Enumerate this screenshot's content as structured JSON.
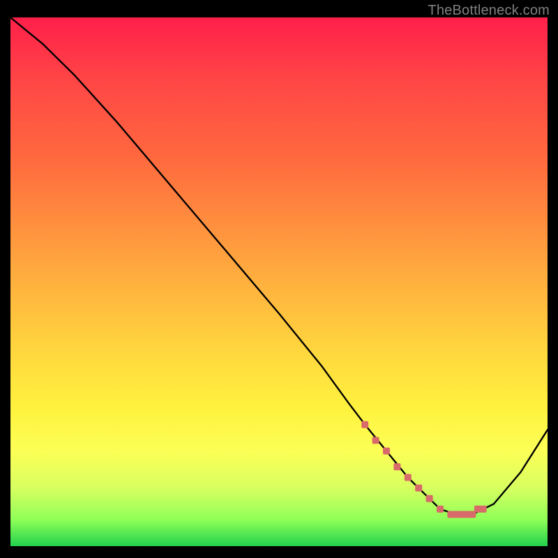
{
  "watermark": "TheBottleneck.com",
  "chart_data": {
    "type": "line",
    "title": "",
    "xlabel": "",
    "ylabel": "",
    "xlim": [
      0,
      100
    ],
    "ylim": [
      0,
      100
    ],
    "series": [
      {
        "name": "bottleneck-curve",
        "x": [
          0,
          6,
          12,
          20,
          30,
          40,
          50,
          58,
          63,
          66,
          70,
          74,
          78,
          80,
          83,
          86,
          90,
          95,
          100
        ],
        "values": [
          100,
          95,
          89,
          80,
          68,
          56,
          44,
          34,
          27,
          23,
          18,
          13,
          9,
          7,
          6,
          6,
          8,
          14,
          22
        ]
      }
    ],
    "highlight": {
      "name": "optimal-range-markers",
      "color": "#d86a6a",
      "x": [
        66,
        68,
        70,
        72,
        74,
        76,
        78,
        80,
        82,
        83,
        84,
        85,
        86,
        87,
        88
      ],
      "values": [
        23,
        20,
        18,
        15,
        13,
        11,
        9,
        7,
        6,
        6,
        6,
        6,
        6,
        7,
        7
      ]
    }
  }
}
